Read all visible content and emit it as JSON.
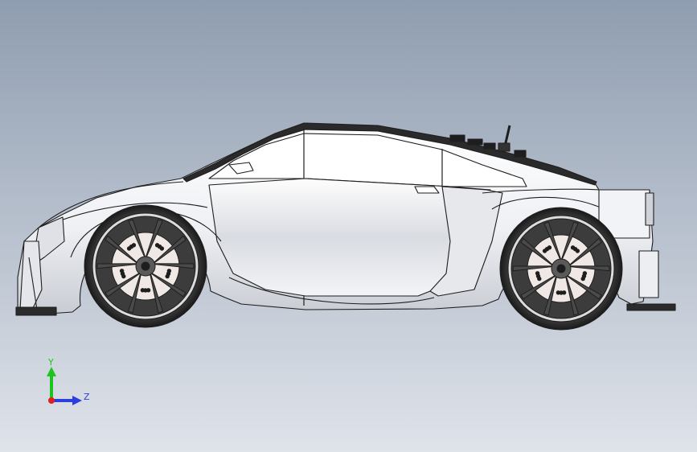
{
  "viewport": {
    "background_top": "#8f9db0",
    "background_bottom": "#dfe3ea"
  },
  "model": {
    "body_color": "#f4f5f8",
    "edge_color": "#1e1e1e",
    "tire_color": "#2e2e2e",
    "rim_color": "#3c3c3c",
    "brake_disc_color": "#f0e8e4"
  },
  "triad": {
    "y_label": "Y",
    "z_label": "Z",
    "y_color": "#1fc31f",
    "z_color": "#2b3fe0",
    "x_color": "#e02020"
  }
}
